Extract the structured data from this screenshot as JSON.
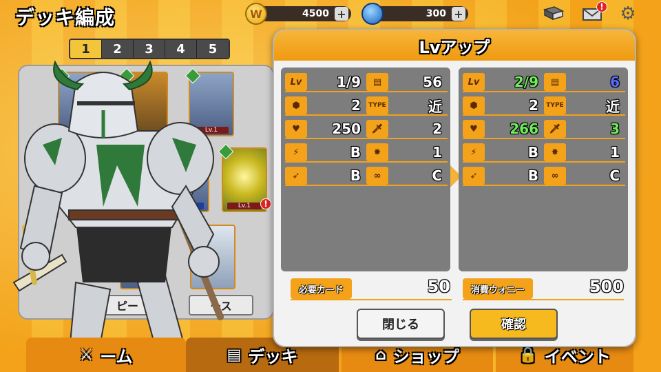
{
  "screen": {
    "title": "デッキ編成"
  },
  "currencies": {
    "gold": {
      "icon": "gold-coin-icon",
      "symbol": "W",
      "amount": "4500"
    },
    "gem": {
      "icon": "blue-gem-icon",
      "amount": "300"
    }
  },
  "deck_tabs": [
    "1",
    "2",
    "3",
    "4",
    "5"
  ],
  "deck_tab_selected": 1,
  "deck_panel": {
    "card_level_labels": [
      "Lv.1",
      "Lv.1",
      "Lv.1"
    ],
    "buttons": [
      "ピー",
      "ース"
    ]
  },
  "bottom_nav": [
    {
      "label": "ーム",
      "icon": "sword-icon"
    },
    {
      "label": "デッキ",
      "icon": "book-icon"
    },
    {
      "label": "ショップ",
      "icon": "shop-icon"
    },
    {
      "label": "イベント",
      "icon": "lock-icon"
    }
  ],
  "modal": {
    "title": "Lvアップ",
    "before": {
      "level": "1/9",
      "cost": "56",
      "mana": "2",
      "type": "近",
      "hp": "250",
      "attack": "2",
      "speed_rank": "B",
      "skill_count": "1",
      "move_rank": "B",
      "range_rank": "C"
    },
    "after": {
      "level": "2/9",
      "cost": "6",
      "mana": "2",
      "type": "近",
      "hp": "266",
      "attack": "3",
      "speed_rank": "B",
      "skill_count": "1",
      "move_rank": "B",
      "range_rank": "C"
    },
    "icon_labels": {
      "level": "Lv",
      "type": "TYPE"
    },
    "required_cards_label": "必要カード",
    "required_cards_value": "50",
    "cost_label": "消費ウォニー",
    "cost_value": "500",
    "close_label": "閉じる",
    "confirm_label": "確認"
  },
  "colors": {
    "accent_orange": "#f3a21a",
    "increase_green": "#6ff05a",
    "decrease_blue": "#5a6cff",
    "badge_red": "#e12222"
  }
}
